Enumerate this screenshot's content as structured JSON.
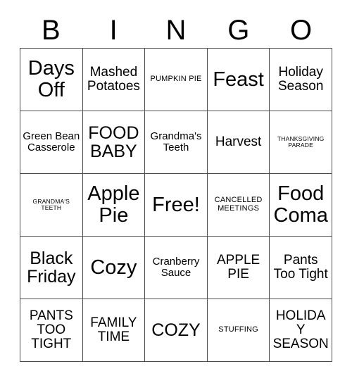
{
  "card": {
    "header_letters": [
      "B",
      "I",
      "N",
      "G",
      "O"
    ],
    "rows": [
      [
        {
          "text": "Days Off",
          "size": "xl"
        },
        {
          "text": "Mashed Potatoes",
          "size": "md"
        },
        {
          "text": "PUMPKIN PIE",
          "size": "xs"
        },
        {
          "text": "Feast",
          "size": "xl"
        },
        {
          "text": "Holiday Season",
          "size": "md"
        }
      ],
      [
        {
          "text": "Green Bean Casserole",
          "size": "sm"
        },
        {
          "text": "FOOD BABY",
          "size": "lg"
        },
        {
          "text": "Grandma's Teeth",
          "size": "sm"
        },
        {
          "text": "Harvest",
          "size": "md"
        },
        {
          "text": "THANKSGIVING PARADE",
          "size": "xxs"
        }
      ],
      [
        {
          "text": "GRANDMA'S TEETH",
          "size": "xxs"
        },
        {
          "text": "Apple Pie",
          "size": "xl"
        },
        {
          "text": "Free!",
          "size": "xl"
        },
        {
          "text": "CANCELLED MEETINGS",
          "size": "xs"
        },
        {
          "text": "Food Coma",
          "size": "xl"
        }
      ],
      [
        {
          "text": "Black Friday",
          "size": "lg"
        },
        {
          "text": "Cozy",
          "size": "xl"
        },
        {
          "text": "Cranberry Sauce",
          "size": "sm"
        },
        {
          "text": "APPLE PIE",
          "size": "md"
        },
        {
          "text": "Pants Too Tight",
          "size": "md"
        }
      ],
      [
        {
          "text": "PANTS TOO TIGHT",
          "size": "md"
        },
        {
          "text": "FAMILY TIME",
          "size": "md"
        },
        {
          "text": "COZY",
          "size": "lg"
        },
        {
          "text": "STUFFING",
          "size": "xs"
        },
        {
          "text": "HOLIDAY SEASON",
          "size": "md"
        }
      ]
    ]
  },
  "colors": {
    "background": "#ffffff",
    "text": "#000000",
    "border": "#4d4d4d"
  }
}
